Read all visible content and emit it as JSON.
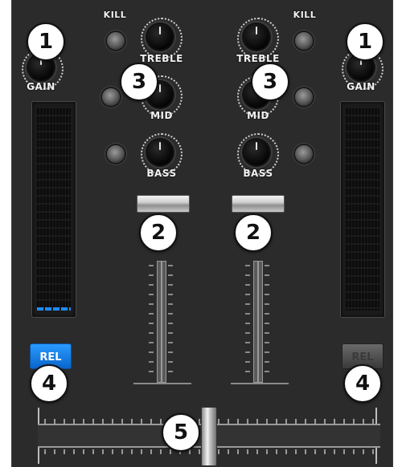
{
  "mixer": {
    "labels": {
      "kill": "KILL",
      "gain": "GAIN",
      "treble": "TREBLE",
      "mid": "MID",
      "bass": "BASS",
      "rel": "REL"
    },
    "callouts": {
      "gain": "1",
      "channel_fader": "2",
      "eq": "3",
      "rel": "4",
      "crossfader": "5"
    },
    "state": {
      "left_rel_active": true,
      "right_rel_active": false,
      "crossfader_position": 0.5
    },
    "colors": {
      "panel": "#2b2b2b",
      "meter_level": "#1e8bff",
      "rel_active": "#1e8bff",
      "callout_fill": "#ffffff"
    }
  }
}
